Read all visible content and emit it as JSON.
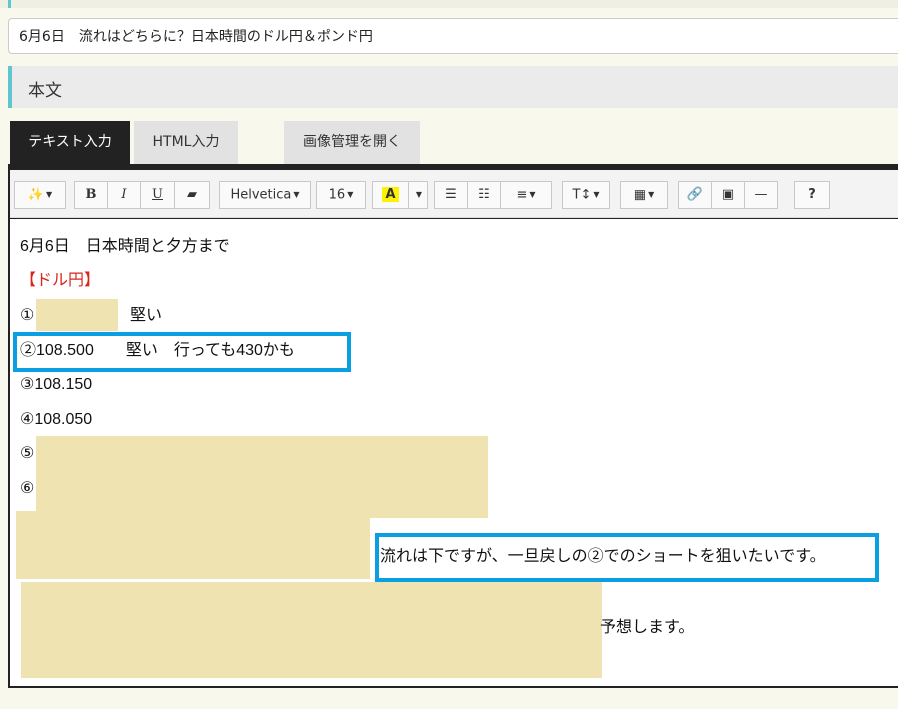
{
  "title_field": {
    "value": "6月6日　流れはどちらに？日本時間のドル円＆ポンド円"
  },
  "section": {
    "label": "本文"
  },
  "tabs": {
    "text_input": "テキスト入力",
    "html_input": "HTML入力",
    "image_manager": "画像管理を開く"
  },
  "toolbar": {
    "magic": "magic-wand-icon",
    "bold": "B",
    "italic": "I",
    "underline": "U",
    "eraser": "eraser-icon",
    "font_family": "Helvetica",
    "font_size": "16",
    "highlight": "A",
    "help": "?"
  },
  "content": {
    "line1": "6月6日　日本時間と夕方まで",
    "line2": "【ドル円】",
    "line3_prefix": "①",
    "line3_suffix": "堅い",
    "line4": "②108.500　　堅い　行っても430かも",
    "line5": "③108.150",
    "line6": "④108.050",
    "line7": "⑤",
    "line8": "⑥",
    "line9": "流れは下ですが、一旦戻しの②でのショートを狙いたいです。",
    "line10": "予想します。"
  },
  "colors": {
    "accent": "#5fc6cf",
    "highlight_box": "#0a9fe0",
    "redaction": "#efe3b1",
    "red_text": "#d9261c"
  }
}
